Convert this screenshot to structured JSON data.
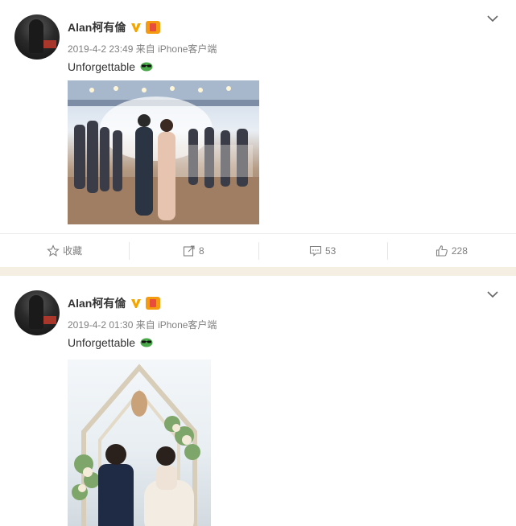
{
  "posts": [
    {
      "username": "Alan柯有倫",
      "meta": "2019-4-2 23:49 来自 iPhone客户端",
      "text": "Unforgettable",
      "actions": {
        "favorite": "收藏",
        "repost": "8",
        "comment": "53",
        "like": "228"
      }
    },
    {
      "username": "Alan柯有倫",
      "meta": "2019-4-2 01:30 来自 iPhone客户端",
      "text": "Unforgettable"
    }
  ],
  "colors": {
    "verified": "#f3a600",
    "meta": "#808080",
    "separator": "#f5eee2"
  },
  "icons": [
    "chevron-down-icon",
    "verified-v-icon",
    "vip-badge-icon",
    "star-icon",
    "repost-icon",
    "comment-icon",
    "thumbs-up-icon",
    "sunglasses-emoji-icon"
  ]
}
